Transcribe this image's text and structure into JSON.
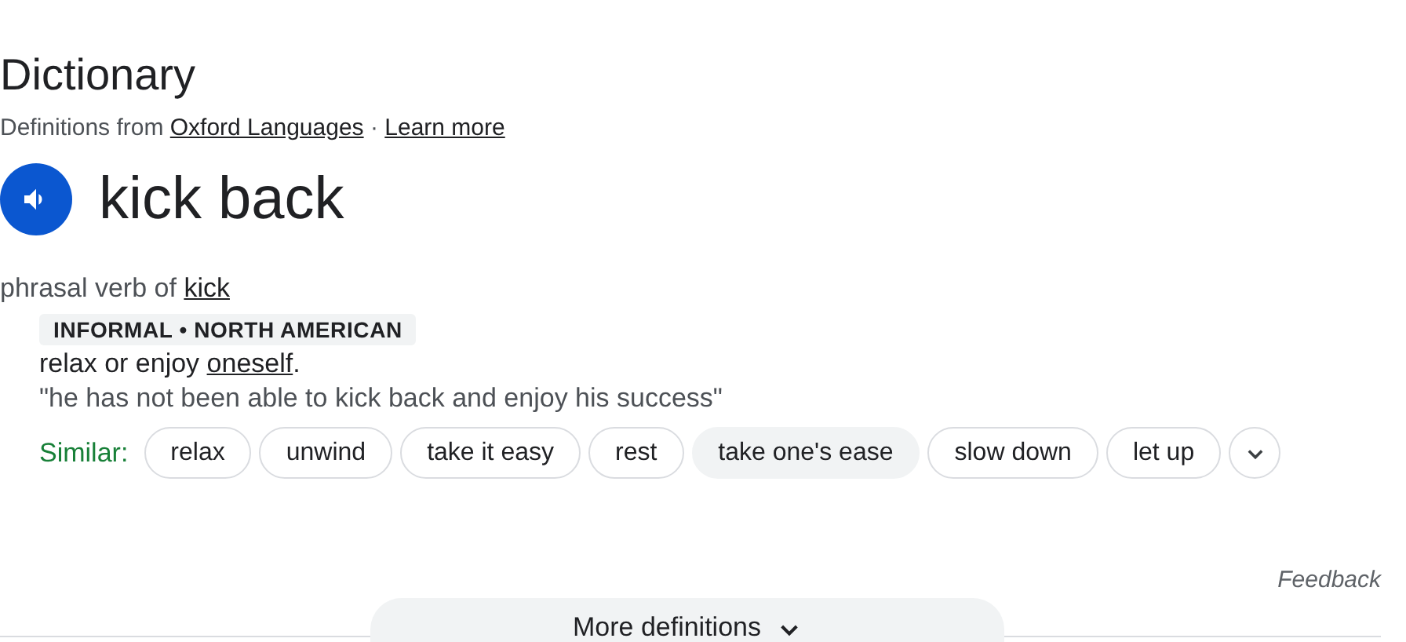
{
  "heading": "Dictionary",
  "source": {
    "prefix": "Definitions from",
    "link": "Oxford Languages",
    "separator": "·",
    "learn_more": "Learn more"
  },
  "entry": {
    "word": "kick back",
    "part_of_speech": {
      "prefix": "phrasal verb of",
      "link": "kick"
    },
    "sense": {
      "labels": "INFORMAL • NORTH AMERICAN",
      "definition": "relax or enjoy",
      "definition_link": "oneself",
      "definition_end": ".",
      "example": "\"he has not been able to kick back and enjoy his success\"",
      "similar_label": "Similar:",
      "similar": [
        {
          "text": "relax",
          "highlighted": false
        },
        {
          "text": "unwind",
          "highlighted": false
        },
        {
          "text": "take it easy",
          "highlighted": false
        },
        {
          "text": "rest",
          "highlighted": false
        },
        {
          "text": "take one's ease",
          "highlighted": true
        },
        {
          "text": "slow down",
          "highlighted": false
        },
        {
          "text": "let up",
          "highlighted": false
        }
      ]
    }
  },
  "feedback": "Feedback",
  "more_button": "More definitions"
}
